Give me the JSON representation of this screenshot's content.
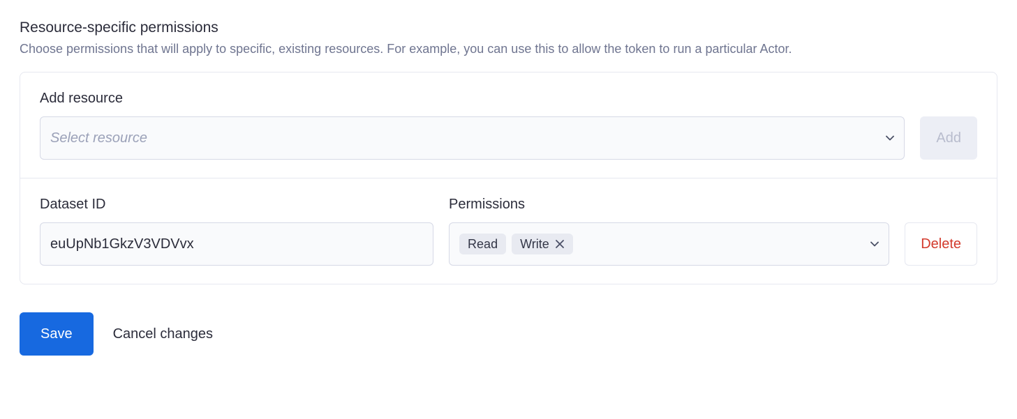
{
  "section": {
    "title": "Resource-specific permissions",
    "description": "Choose permissions that will apply to specific, existing resources. For example, you can use this to allow the token to run a particular Actor."
  },
  "addResource": {
    "label": "Add resource",
    "placeholder": "Select resource",
    "addButton": "Add"
  },
  "resource": {
    "idLabel": "Dataset ID",
    "idValue": "euUpNb1GkzV3VDVvx",
    "permissionsLabel": "Permissions",
    "permissions": [
      "Read",
      "Write"
    ],
    "deleteButton": "Delete"
  },
  "footer": {
    "save": "Save",
    "cancel": "Cancel changes"
  }
}
